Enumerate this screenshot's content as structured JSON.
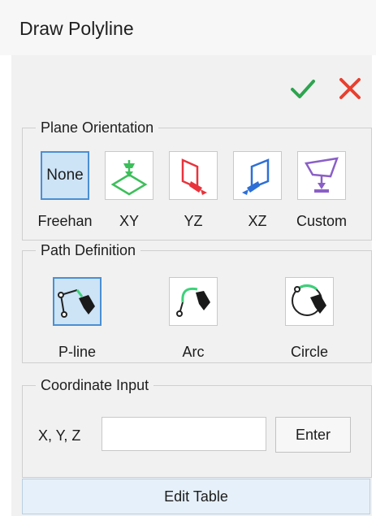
{
  "window": {
    "title": "Draw Polyline"
  },
  "actions": {
    "accept_icon": "checkmark-icon",
    "cancel_icon": "close-icon",
    "accept_color": "#2ea44f",
    "cancel_color": "#e8402f"
  },
  "plane_orientation": {
    "title": "Plane Orientation",
    "selected": "Freehan",
    "buttons": [
      {
        "label": "Freehan",
        "icon_text": "None",
        "icon": "none-icon"
      },
      {
        "label": "XY",
        "icon": "xy-plane-icon"
      },
      {
        "label": "YZ",
        "icon": "yz-plane-icon"
      },
      {
        "label": "XZ",
        "icon": "xz-plane-icon"
      },
      {
        "label": "Custom",
        "icon": "custom-plane-icon"
      }
    ]
  },
  "path_definition": {
    "title": "Path Definition",
    "selected": "P-line",
    "buttons": [
      {
        "label": "P-line",
        "icon": "pline-pen-icon"
      },
      {
        "label": "Arc",
        "icon": "arc-pen-icon"
      },
      {
        "label": "Circle",
        "icon": "circle-pen-icon"
      }
    ]
  },
  "coordinate_input": {
    "title": "Coordinate Input",
    "label": "X, Y, Z",
    "value": "",
    "enter_label": "Enter"
  },
  "edit_table_label": "Edit Table"
}
